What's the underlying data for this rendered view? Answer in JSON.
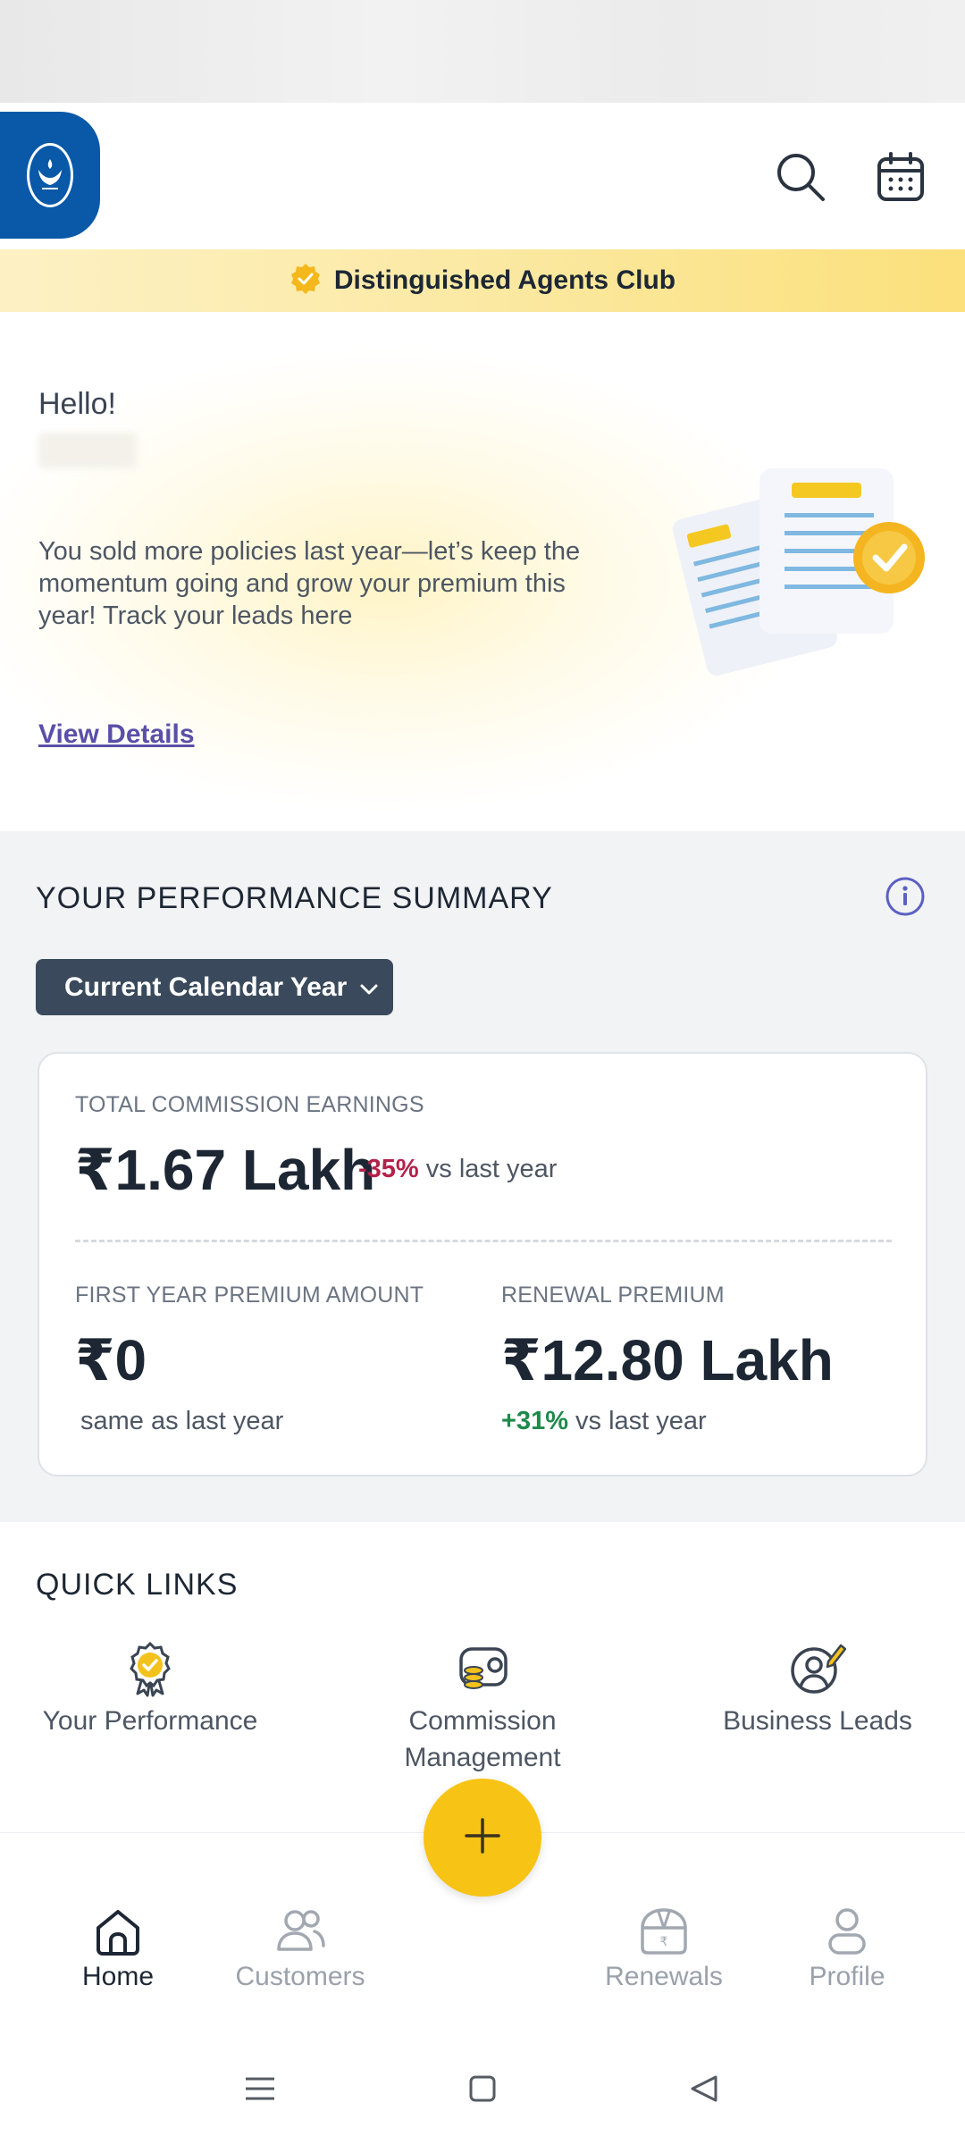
{
  "header": {
    "logo_icon": "lic-hands-lamp-logo",
    "search_icon": "search-icon",
    "calendar_icon": "calendar-icon"
  },
  "banner": {
    "text": "Distinguished Agents Club",
    "badge_icon": "verified-badge-icon"
  },
  "hello_card": {
    "greeting": "Hello!",
    "message": "You sold more policies last year—let’s keep the momentum going and grow your premium this year! Track your leads here",
    "link": "View Details"
  },
  "performance": {
    "title": "YOUR PERFORMANCE SUMMARY",
    "period": "Current Calendar Year",
    "total_commission": {
      "label": "TOTAL COMMISSION EARNINGS",
      "value": "₹1.67 Lakh",
      "delta": "-35%",
      "delta_suffix": "vs last year"
    },
    "first_year_premium": {
      "label": "FIRST YEAR PREMIUM AMOUNT",
      "value": "₹0",
      "note": "same as last year"
    },
    "renewal_premium": {
      "label": "RENEWAL PREMIUM",
      "value": "₹12.80 Lakh",
      "delta": "+31%",
      "delta_suffix": "vs last year"
    }
  },
  "quick_links": {
    "title": "QUICK LINKS",
    "items": [
      {
        "label": "Your Performance",
        "icon": "award-icon"
      },
      {
        "label": "Commission\nManagement",
        "icon": "commission-icon"
      },
      {
        "label": "Business Leads",
        "icon": "user-edit-icon"
      }
    ]
  },
  "bottom_nav": {
    "items": [
      {
        "label": "Home",
        "icon": "home-icon",
        "active": true
      },
      {
        "label": "Customers",
        "icon": "customers-icon",
        "active": false
      },
      {
        "label": "Renewals",
        "icon": "renewals-icon",
        "active": false
      },
      {
        "label": "Profile",
        "icon": "profile-icon",
        "active": false
      }
    ],
    "fab_icon": "plus-icon"
  },
  "colors": {
    "brand_blue": "#0a58a8",
    "accent_yellow": "#f7c315",
    "negative": "#b3214a",
    "positive": "#1d8a4a",
    "link": "#5a4fa8"
  }
}
